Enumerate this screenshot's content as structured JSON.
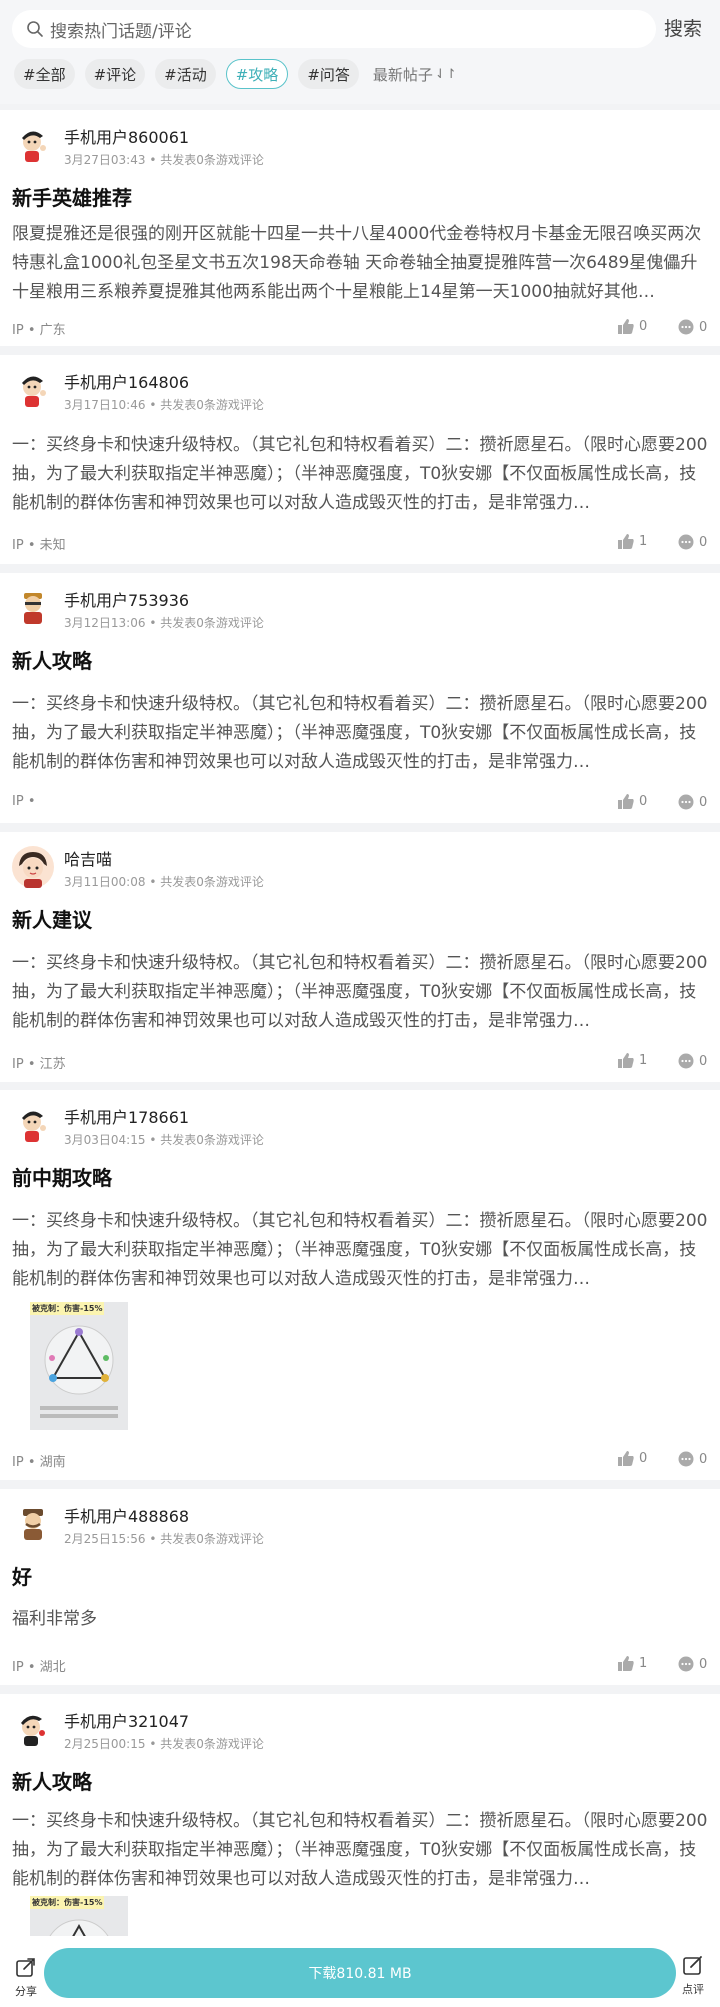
{
  "search": {
    "placeholder": "搜索热门话题/评论",
    "button": "搜索"
  },
  "tabs": [
    "#全部",
    "#评论",
    "#活动",
    "#攻略",
    "#问答"
  ],
  "active_tab": "#攻略",
  "sort": {
    "label": "最新帖子",
    "arrow": "⇃↾"
  },
  "posts": [
    {
      "user": "手机用户860061",
      "time": "3月27日03:43",
      "stat": "共发表0条游戏评论",
      "title": "新手英雄推荐",
      "body": "限夏提雅还是很强的刚开区就能十四星一共十八星4000代金卷特权月卡基金无限召唤买两次特惠礼盒1000礼包圣星文书五次198天命卷轴 天命卷轴全抽夏提雅阵营一次6489星傀儡升十星粮用三系粮养夏提雅其他两系能出两个十星粮能上14星第一天1000抽就好其他…",
      "ip": "IP",
      "region": "广东",
      "likes": "0",
      "comments": "0"
    },
    {
      "user": "手机用户164806",
      "time": "3月17日10:46",
      "stat": "共发表0条游戏评论",
      "title": "",
      "body": "一：买终身卡和快速升级特权。（其它礼包和特权看着买）二：攒祈愿星石。（限时心愿要200抽，为了最大利获取指定半神恶魔）；（半神恶魔强度，T0狄安娜【不仅面板属性成长高，技能机制的群体伤害和神罚效果也可以对敌人造成毁灭性的打击，是非常强力…",
      "ip": "IP",
      "region": "未知",
      "likes": "1",
      "comments": "0"
    },
    {
      "user": "手机用户753936",
      "time": "3月12日13:06",
      "stat": "共发表0条游戏评论",
      "title": "新人攻略",
      "body": "一：买终身卡和快速升级特权。（其它礼包和特权看着买）二：攒祈愿星石。（限时心愿要200抽，为了最大利获取指定半神恶魔）；（半神恶魔强度，T0狄安娜【不仅面板属性成长高，技能机制的群体伤害和神罚效果也可以对敌人造成毁灭性的打击，是非常强力…",
      "ip": "IP",
      "region": "",
      "likes": "0",
      "comments": "0"
    },
    {
      "user": "哈吉喵",
      "time": "3月11日00:08",
      "stat": "共发表0条游戏评论",
      "title": "新人建议",
      "body": "一：买终身卡和快速升级特权。（其它礼包和特权看着买）二：攒祈愿星石。（限时心愿要200抽，为了最大利获取指定半神恶魔）；（半神恶魔强度，T0狄安娜【不仅面板属性成长高，技能机制的群体伤害和神罚效果也可以对敌人造成毁灭性的打击，是非常强力…",
      "ip": "IP",
      "region": "江苏",
      "likes": "1",
      "comments": "0"
    },
    {
      "user": "手机用户178661",
      "time": "3月03日04:15",
      "stat": "共发表0条游戏评论",
      "title": "前中期攻略",
      "body": "一：买终身卡和快速升级特权。（其它礼包和特权看着买）二：攒祈愿星石。（限时心愿要200抽，为了最大利获取指定半神恶魔）；（半神恶魔强度，T0狄安娜【不仅面板属性成长高，技能机制的群体伤害和神罚效果也可以对敌人造成毁灭性的打击，是非常强力…",
      "image_caption": "被克制：伤害-15%",
      "ip": "IP",
      "region": "湖南",
      "likes": "0",
      "comments": "0"
    },
    {
      "user": "手机用户488868",
      "time": "2月25日15:56",
      "stat": "共发表0条游戏评论",
      "title": "好",
      "body": "福利非常多",
      "ip": "IP",
      "region": "湖北",
      "likes": "1",
      "comments": "0"
    },
    {
      "user": "手机用户321047",
      "time": "2月25日00:15",
      "stat": "共发表0条游戏评论",
      "title": "新人攻略",
      "body": "一：买终身卡和快速升级特权。（其它礼包和特权看着买）二：攒祈愿星石。（限时心愿要200抽，为了最大利获取指定半神恶魔）；（半神恶魔强度，T0狄安娜【不仅面板属性成长高，技能机制的群体伤害和神罚效果也可以对敌人造成毁灭性的打击，是非常强力…",
      "image_caption": "被克制：伤害-15%"
    }
  ],
  "bottom": {
    "share": "分享",
    "download": "下载810.81 MB",
    "review": "点评"
  },
  "colors": {
    "accent": "#5cc6cf",
    "active_tab_text": "#3fb0b8"
  }
}
